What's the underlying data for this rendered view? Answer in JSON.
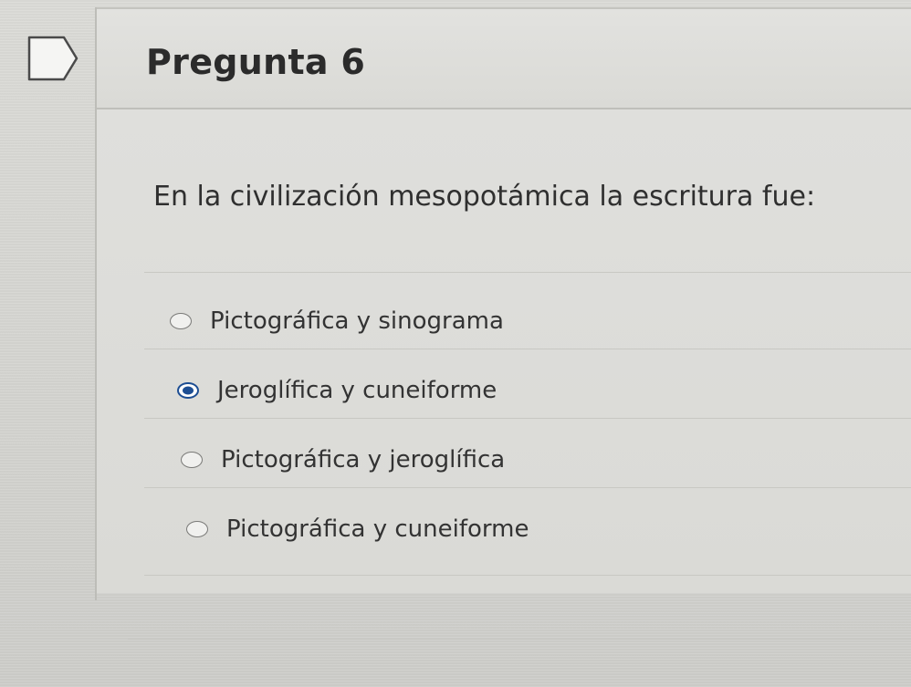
{
  "question": {
    "title": "Pregunta 6",
    "text": "En la civilización mesopotámica la escritura fue:",
    "selected_index": 1,
    "options": [
      {
        "label": "Pictográfica y sinograma"
      },
      {
        "label": "Jeroglífica y cuneiforme"
      },
      {
        "label": "Pictográfica y jeroglífica"
      },
      {
        "label": "Pictográfica y cuneiforme"
      }
    ]
  },
  "colors": {
    "selected_radio": "#1d4e93"
  },
  "icons": {
    "flag": "flag-outline-icon"
  }
}
